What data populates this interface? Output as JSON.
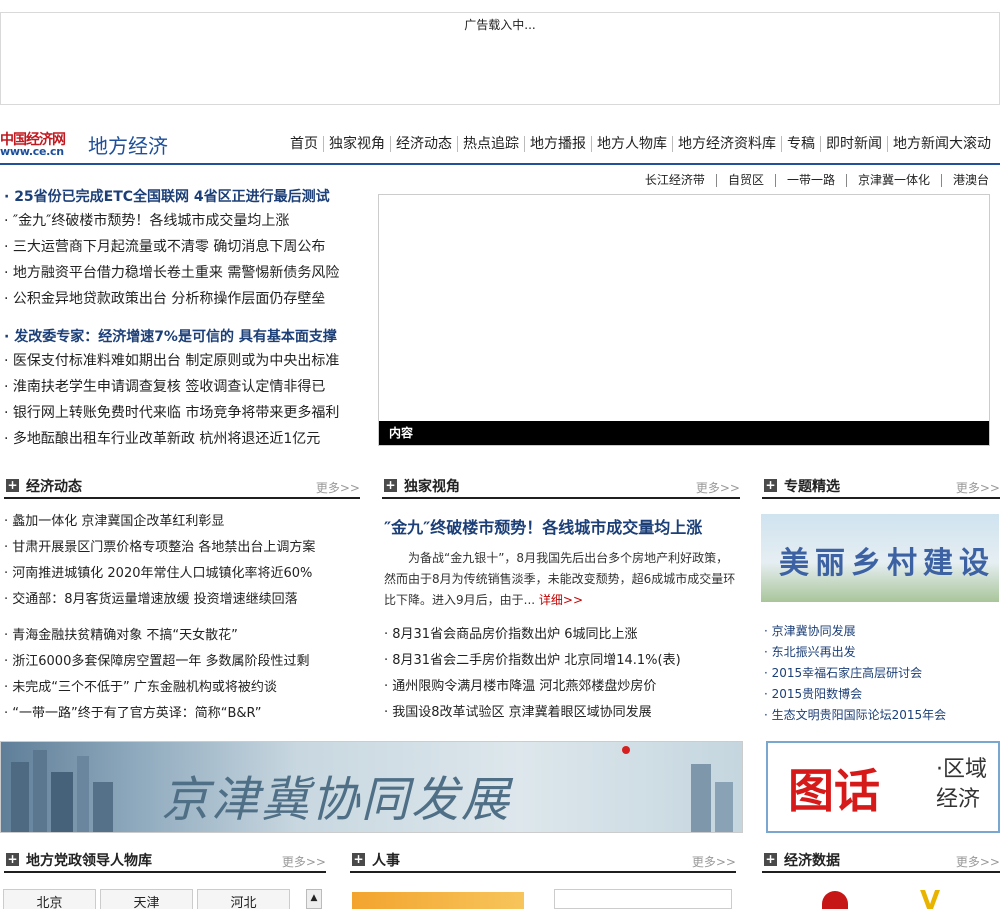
{
  "ad": {
    "text": "广告载入中..."
  },
  "header": {
    "logo_cn": "中国经济网",
    "logo_url": "www.ce.cn",
    "channel": "地方经济",
    "nav": [
      "首页",
      "独家视角",
      "经济动态",
      "热点追踪",
      "地方播报",
      "地方人物库",
      "地方经济资料库",
      "专稿",
      "即时新闻",
      "地方新闻大滚动"
    ]
  },
  "subnav": [
    "长江经济带",
    "自贸区",
    "一带一路",
    "京津冀一体化",
    "港澳台"
  ],
  "headlines": {
    "group1_lead": "· 25省份已完成ETC全国联网 4省区正进行最后测试",
    "group1": [
      "· ″金九″终破楼市颓势！各线城市成交量均上涨",
      "· 三大运营商下月起流量或不清零 确切消息下周公布",
      "· 地方融资平台借力稳增长卷土重来 需警惕新债务风险",
      "· 公积金异地贷款政策出台 分析称操作层面仍存壁垒"
    ],
    "group2_lead": "· 发改委专家：经济增速7%是可信的 具有基本面支撑",
    "group2": [
      "· 医保支付标准料难如期出台 制定原则或为中央出标准",
      "· 淮南扶老学生申请调查复核 签收调查认定情非得已",
      "· 银行网上转账免费时代来临 市场竞争将带来更多福利",
      "· 多地酝酿出租车行业改革新政 杭州将退还近1亿元"
    ]
  },
  "slider": {
    "caption": "内容"
  },
  "sections": {
    "econ": {
      "title": "经济动态",
      "more": "更多>>",
      "list1": [
        "· 蠡加一体化 京津冀国企改革红利彰显",
        "· 甘肃开展景区门票价格专项整治 各地禁出台上调方案",
        "· 河南推进城镇化 2020年常住人口城镇化率将近60%",
        "· 交通部：8月客货运量增速放缓 投资增速继续回落"
      ],
      "list2": [
        "· 青海金融扶贫精确对象 不搞“天女散花”",
        "· 浙江6000多套保障房空置超一年 多数属阶段性过剩",
        "· 未完成“三个不低于” 广东金融机构或将被约谈",
        "· “一带一路”终于有了官方英译：简称“B&R”"
      ]
    },
    "exclusive": {
      "title": "独家视角",
      "more": "更多>>",
      "feature_title": "″金九″终破楼市颓势！各线城市成交量均上涨",
      "feature_body": "为备战“金九银十”，8月我国先后出台多个房地产利好政策，然而由于8月为传统销售淡季，未能改变颓势，超6成城市成交量环比下降。进入9月后，由于...",
      "detail": "详细>>",
      "list": [
        "· 8月31省会商品房价指数出炉 6城同比上涨",
        "· 8月31省会二手房价指数出炉 北京同增14.1%(表)",
        "· 通州限购令满月楼市降温 河北燕郊楼盘炒房价",
        "· 我国设8改革试验区 京津冀着眼区域协同发展"
      ]
    },
    "topics": {
      "title": "专题精选",
      "more": "更多>>",
      "image_text": "美丽乡村建设",
      "list": [
        "· 京津冀协同发展",
        "· 东北振兴再出发",
        "· 2015幸福石家庄高层研讨会",
        "· 2015贵阳数博会",
        "· 生态文明贵阳国际论坛2015年会"
      ]
    },
    "leaders": {
      "title": "地方党政领导人物库",
      "more": "更多>>",
      "tabs": [
        "北京",
        "天津",
        "河北"
      ]
    },
    "personnel": {
      "title": "人事",
      "more": "更多>>"
    },
    "econdata": {
      "title": "经济数据",
      "more": "更多>>"
    }
  },
  "banners": {
    "left_text": "京津冀协同发展",
    "right_a": "图话",
    "right_b": "·区域经济"
  }
}
